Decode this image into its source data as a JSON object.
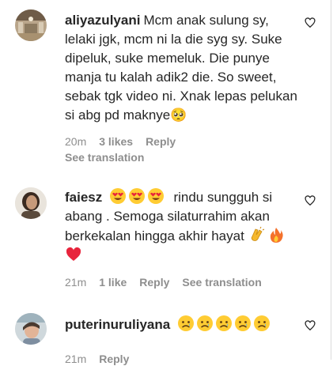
{
  "comments": [
    {
      "username": "aliyazulyani",
      "text": "Mcm anak sulung sy, lelaki jgk, mcm ni la die syg sy. Suke dipeluk, suke memeluk. Die punye manja tu kalah adik2 die. So sweet, sebak tgk video ni. Xnak lepas pelukan si abg pd maknye🥺",
      "time": "20m",
      "likes": "3 likes",
      "reply_label": "Reply",
      "see_translation": "See translation",
      "avatar": "avatar-photo-room"
    },
    {
      "username": "faiesz",
      "emoji_prefix": [
        "heart-eyes-emoji",
        "heart-eyes-emoji",
        "heart-eyes-emoji"
      ],
      "text": "rindu sungguh si abang . Semoga silaturrahim akan berkekalan hingga akhir hayat",
      "emoji_suffix": [
        "clapping-hands-emoji",
        "fire-emoji",
        "red-heart-emoji"
      ],
      "time": "21m",
      "likes": "1 like",
      "reply_label": "Reply",
      "see_translation": "See translation",
      "avatar": "avatar-photo-woman"
    },
    {
      "username": "puterinuruliyana",
      "emoji_prefix": [
        "sad-face-emoji",
        "sad-face-emoji",
        "sad-face-emoji",
        "sad-face-emoji",
        "sad-face-emoji"
      ],
      "time": "21m",
      "reply_label": "Reply",
      "avatar": "avatar-photo-child"
    }
  ],
  "colors": {
    "text": "#262626",
    "secondary": "#8e8e8e",
    "heart_red": "#ed4956"
  },
  "icons": {
    "like": "heart-outline-icon"
  }
}
